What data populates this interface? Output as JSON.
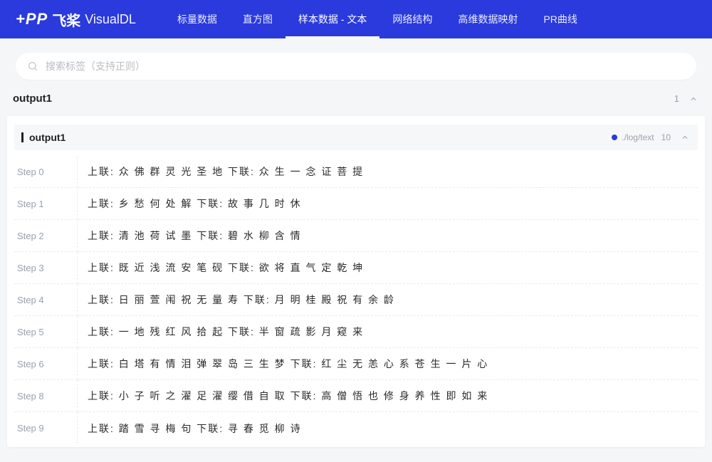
{
  "brand": {
    "mark": "+PP",
    "name_cn": "飞桨",
    "product": "VisualDL"
  },
  "nav": {
    "items": [
      {
        "label": "标量数据",
        "active": false
      },
      {
        "label": "直方图",
        "active": false
      },
      {
        "label": "样本数据 - 文本",
        "active": true
      },
      {
        "label": "网络结构",
        "active": false
      },
      {
        "label": "高维数据映射",
        "active": false
      },
      {
        "label": "PR曲线",
        "active": false
      }
    ]
  },
  "search": {
    "placeholder": "搜索标签（支持正则）"
  },
  "section": {
    "title": "output1",
    "count": "1"
  },
  "card": {
    "title": "output1",
    "run_path": "./log/text",
    "run_count": "10"
  },
  "rows": [
    {
      "step": "Step 0",
      "text": "上联: 众 佛 群 灵 光 圣 地 下联: 众 生 一 念 证 菩 提"
    },
    {
      "step": "Step 1",
      "text": "上联: 乡 愁 何 处 解 下联: 故 事 几 时 休"
    },
    {
      "step": "Step 2",
      "text": "上联: 清 池 荷 试 墨 下联: 碧 水 柳 含 情"
    },
    {
      "step": "Step 3",
      "text": "上联: 既 近 浅 流 安 笔 砚 下联: 欲 将 直 气 定 乾 坤"
    },
    {
      "step": "Step 4",
      "text": "上联: 日 丽 萱 闱 祝 无 量 寿 下联: 月 明 桂 殿 祝 有 余 龄"
    },
    {
      "step": "Step 5",
      "text": "上联: 一 地 残 红 风 拾 起 下联: 半 窗 疏 影 月 窥 来"
    },
    {
      "step": "Step 6",
      "text": "上联: 白 塔 有 情 泪 弹 翠 岛 三 生 梦 下联: 红 尘 无 恙 心 系 苍 生 一 片 心"
    },
    {
      "step": "Step 8",
      "text": "上联: 小 子 听 之 濯 足 濯 缨 借 自 取 下联: 高 僧 悟 也 修 身 养 性 即 如 来"
    },
    {
      "step": "Step 9",
      "text": "上联: 踏 雪 寻 梅 句 下联: 寻 春 觅 柳 诗"
    }
  ]
}
